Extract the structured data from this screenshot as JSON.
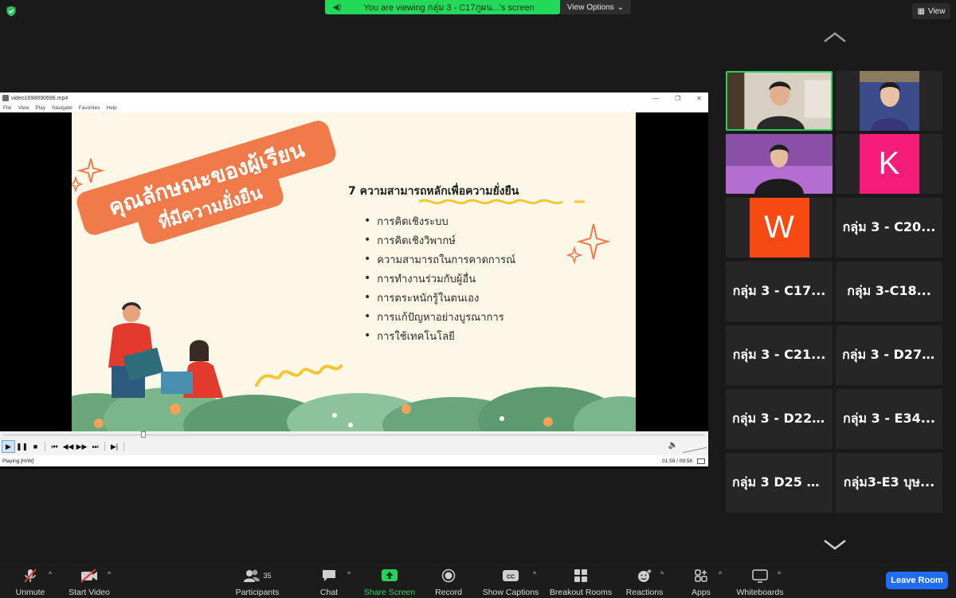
{
  "top_bar": {
    "share_banner": "You are viewing กลุ่ม 3 - C17ภูผน...'s screen",
    "view_options": "View Options",
    "view_button": "View",
    "colors": {
      "banner_green": "#23d959"
    }
  },
  "player": {
    "title": "video1698890696.mp4",
    "menu": [
      "File",
      "View",
      "Play",
      "Navigate",
      "Favorites",
      "Help"
    ],
    "status": "Playing [H/W]",
    "time": "01:59 / 09:58",
    "progress_fraction": 0.2
  },
  "slide": {
    "banner_line1": "คุณลักษณะของผู้เรียน",
    "banner_line2": "ที่มีความยั่งยืน",
    "heading": "7 ความสามารถหลักเพื่อความยั่งยืน",
    "bullets": [
      "การคิดเชิงระบบ",
      "การคิดเชิงวิพากษ์",
      "ความสามารถในการคาดการณ์",
      "การทำงานร่วมกับผู้อื่น",
      "การตระหนักรู้ในตนเอง",
      "การแก้ปัญหาอย่างบูรณาการ",
      "การใช้เทคโนโลยี"
    ],
    "colors": {
      "accent": "#f07a4a",
      "background": "#fdf7e7"
    }
  },
  "gallery": {
    "avatars": {
      "k": {
        "letter": "K",
        "color": "#f51c7a"
      },
      "w": {
        "letter": "W",
        "color": "#f74a12"
      }
    },
    "names": [
      "กลุ่ม 3 - C20...",
      "กลุ่ม 3 - C17...",
      "กลุ่ม 3-C18...",
      "กลุ่ม 3 - C21...",
      "กลุ่ม 3 - D27...",
      "กลุ่ม 3 - D22...",
      "กลุ่ม 3 - E34...",
      "กลุ่ม 3 D25 สั...",
      "กลุ่ม3-E3 บุษ..."
    ]
  },
  "toolbar": {
    "unmute": "Unmute",
    "start_video": "Start Video",
    "participants": "Participants",
    "participants_count": "35",
    "chat": "Chat",
    "share_screen": "Share Screen",
    "record": "Record",
    "show_captions": "Show Captions",
    "breakout_rooms": "Breakout Rooms",
    "reactions": "Reactions",
    "apps": "Apps",
    "whiteboards": "Whiteboards",
    "leave": "Leave Room",
    "colors": {
      "leave_blue": "#1f6cf5",
      "share_green": "#24d35c"
    }
  }
}
